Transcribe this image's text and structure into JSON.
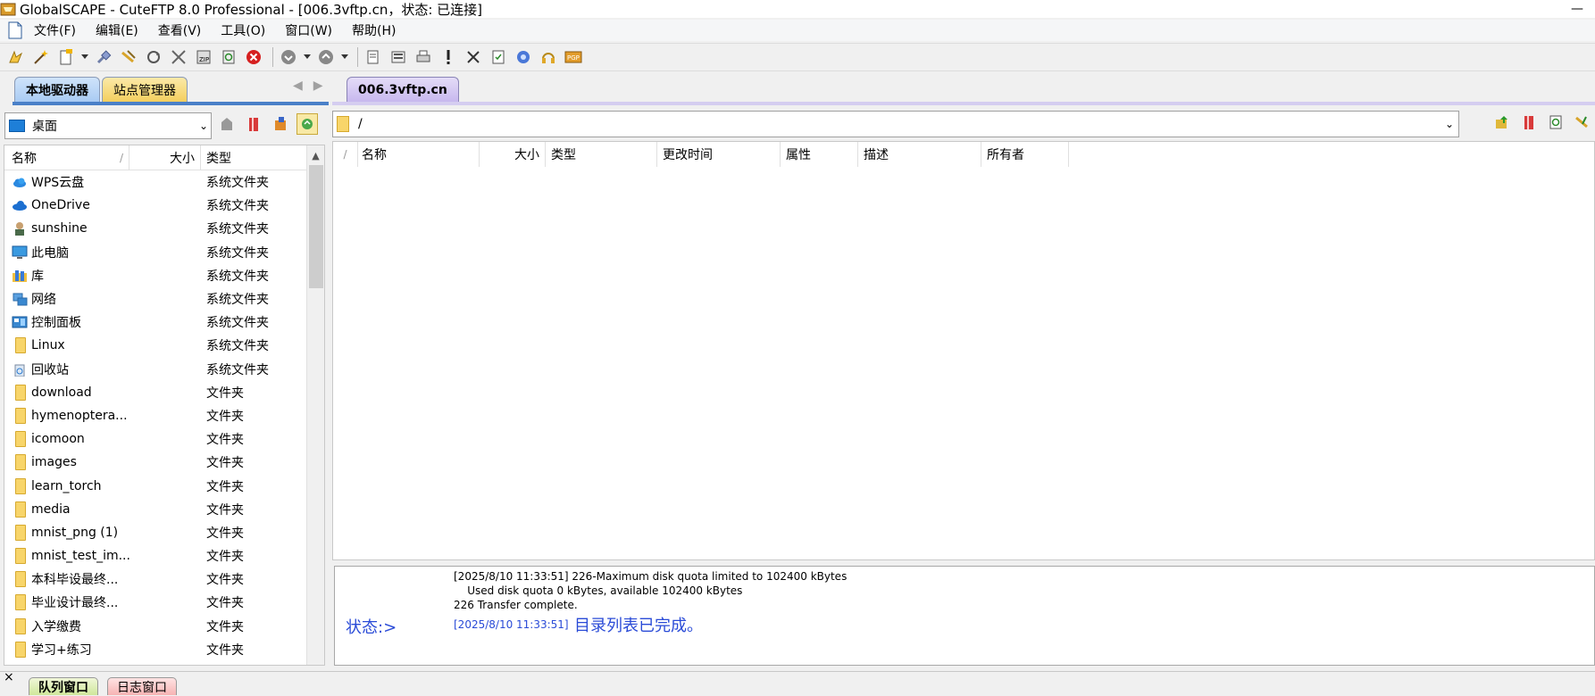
{
  "window": {
    "title": "GlobalSCAPE - CuteFTP 8.0 Professional - [006.3vftp.cn，状态: 已连接]",
    "minimize": "—"
  },
  "menu": [
    "文件(F)",
    "编辑(E)",
    "查看(V)",
    "工具(O)",
    "窗口(W)",
    "帮助(H)"
  ],
  "toolbar": {
    "groups": [
      [
        "connect-wizard",
        "quick-connect",
        "new-site",
        "new-site-menu",
        "connect",
        "disconnect",
        "reconnect",
        "stop-transfer",
        "compress",
        "refresh",
        "cancel"
      ],
      [
        "download",
        "download-menu",
        "upload",
        "upload-menu"
      ],
      [
        "edit",
        "view",
        "print",
        "error",
        "delete",
        "properties",
        "options",
        "help",
        "pgp"
      ]
    ]
  },
  "left_panel": {
    "tabs": [
      "本地驱动器",
      "站点管理器"
    ],
    "nav": [
      "◀",
      "▶"
    ],
    "path": "桌面",
    "columns": [
      "名称",
      "大小",
      "类型"
    ],
    "sort_indicator": "/",
    "rows": [
      {
        "name": "WPS云盘",
        "type": "系统文件夹",
        "icon": "cloud-icon"
      },
      {
        "name": "OneDrive",
        "type": "系统文件夹",
        "icon": "onedrive-icon"
      },
      {
        "name": "sunshine",
        "type": "系统文件夹",
        "icon": "user-icon"
      },
      {
        "name": "此电脑",
        "type": "系统文件夹",
        "icon": "computer-icon"
      },
      {
        "name": "库",
        "type": "系统文件夹",
        "icon": "library-icon"
      },
      {
        "name": "网络",
        "type": "系统文件夹",
        "icon": "network-icon"
      },
      {
        "name": "控制面板",
        "type": "系统文件夹",
        "icon": "control-panel-icon"
      },
      {
        "name": "Linux",
        "type": "系统文件夹",
        "icon": "folder-icon"
      },
      {
        "name": "回收站",
        "type": "系统文件夹",
        "icon": "recycle-bin-icon"
      },
      {
        "name": "download",
        "type": "文件夹",
        "icon": "folder-icon"
      },
      {
        "name": "hymenoptera...",
        "type": "文件夹",
        "icon": "folder-icon"
      },
      {
        "name": "icomoon",
        "type": "文件夹",
        "icon": "folder-icon"
      },
      {
        "name": "images",
        "type": "文件夹",
        "icon": "folder-icon"
      },
      {
        "name": "learn_torch",
        "type": "文件夹",
        "icon": "folder-icon"
      },
      {
        "name": "media",
        "type": "文件夹",
        "icon": "folder-icon"
      },
      {
        "name": "mnist_png (1)",
        "type": "文件夹",
        "icon": "folder-icon"
      },
      {
        "name": "mnist_test_im...",
        "type": "文件夹",
        "icon": "folder-icon"
      },
      {
        "name": "本科毕设最终...",
        "type": "文件夹",
        "icon": "folder-icon"
      },
      {
        "name": "毕业设计最终...",
        "type": "文件夹",
        "icon": "folder-icon"
      },
      {
        "name": "入学缴费",
        "type": "文件夹",
        "icon": "folder-icon"
      },
      {
        "name": "学习+练习",
        "type": "文件夹",
        "icon": "folder-icon"
      }
    ]
  },
  "right_panel": {
    "tab": "006.3vftp.cn",
    "path": "/",
    "sort_indicator": "/",
    "columns": [
      "名称",
      "大小",
      "类型",
      "更改时间",
      "属性",
      "描述",
      "所有者"
    ]
  },
  "log": {
    "lines": [
      "[2025/8/10 11:33:51] 226-Maximum disk quota limited to 102400 kBytes",
      "    Used disk quota 0 kBytes, available 102400 kBytes",
      "226 Transfer complete."
    ],
    "status_label": "状态:>",
    "status_time": "[2025/8/10 11:33:51]",
    "status_message": "目录列表已完成。"
  },
  "bottom": {
    "close": "×",
    "tabs": [
      "队列窗口",
      "日志窗口"
    ]
  },
  "colors": {
    "local_tab": "#a9cbf3",
    "site_tab": "#f4cf5e",
    "remote_tab": "#c7b8ee",
    "status_blue": "#2a4bd7",
    "folder": "#f8d56a"
  }
}
